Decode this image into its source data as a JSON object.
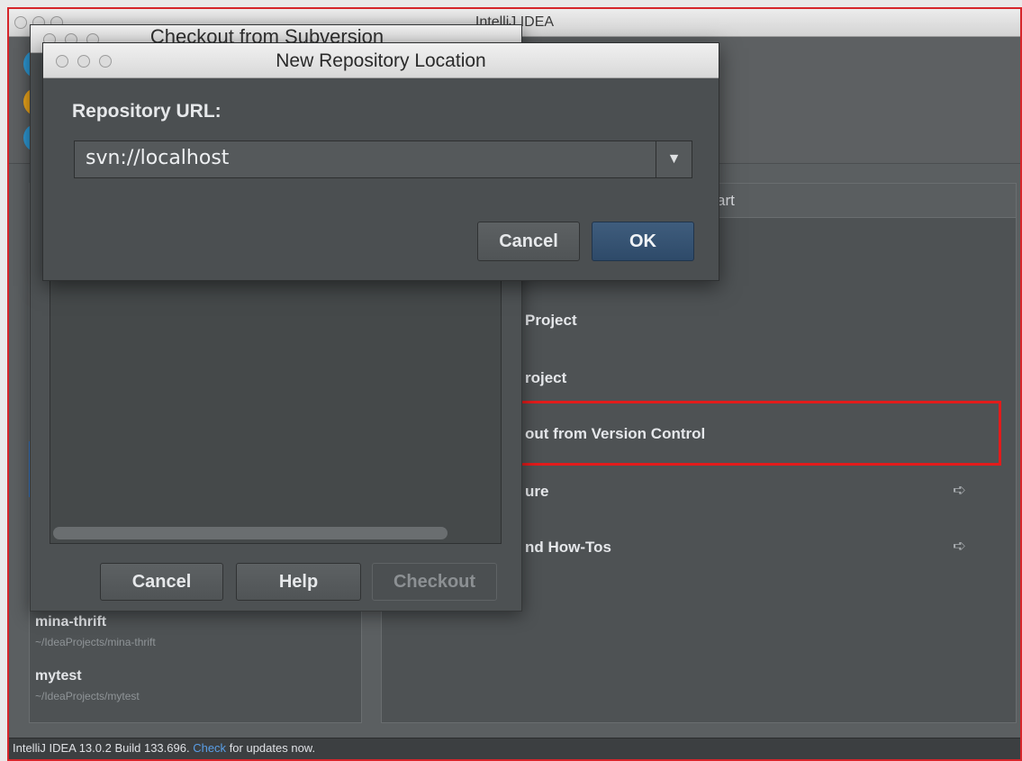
{
  "main_window": {
    "title": "IntelliJ IDEA"
  },
  "quick_start": {
    "header_fragment": "art",
    "items": [
      {
        "label": "Project",
        "has_arrow": false
      },
      {
        "label": "roject",
        "has_arrow": false
      },
      {
        "label": "out from Version Control",
        "has_arrow": false
      },
      {
        "label": "ure",
        "has_arrow": true
      },
      {
        "label": "nd How-Tos",
        "has_arrow": true
      }
    ]
  },
  "recent_projects": [
    {
      "name": "mina-thrift",
      "path": "~/IdeaProjects/mina-thrift"
    },
    {
      "name": "mytest",
      "path": "~/IdeaProjects/mytest"
    }
  ],
  "status_bar": {
    "prefix": "IntelliJ IDEA 13.0.2 Build 133.696.",
    "link": "Check",
    "suffix": "for updates now."
  },
  "checkout_dialog": {
    "title": "Checkout from Subversion",
    "buttons": {
      "cancel": "Cancel",
      "help": "Help",
      "checkout": "Checkout"
    }
  },
  "repo_dialog": {
    "title": "New Repository Location",
    "url_label": "Repository URL:",
    "url_value": "svn://localhost",
    "buttons": {
      "cancel": "Cancel",
      "ok": "OK"
    }
  },
  "colors": {
    "highlight": "#e21b1b",
    "accent_blue": "#3b7ed0",
    "link": "#5a9ee6"
  }
}
